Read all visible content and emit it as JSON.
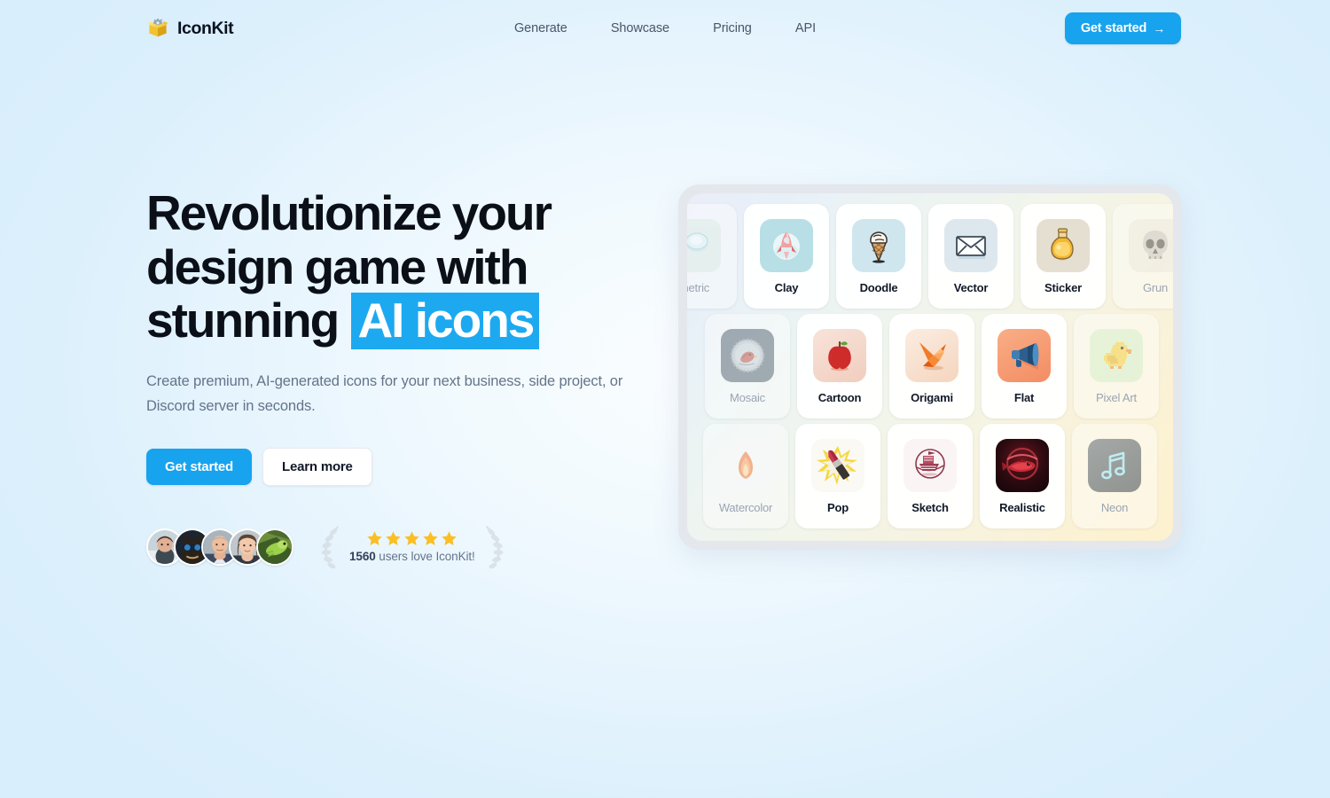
{
  "brand": {
    "name": "IconKit",
    "logo_icon": "gear-in-box-icon"
  },
  "nav": {
    "items": [
      {
        "label": "Generate"
      },
      {
        "label": "Showcase"
      },
      {
        "label": "Pricing"
      },
      {
        "label": "API"
      }
    ],
    "cta": {
      "label": "Get started",
      "arrow": "→"
    }
  },
  "hero": {
    "headline_plain": "Revolutionize your design game with stunning ",
    "headline_highlight": "AI icons",
    "subhead": "Create premium, AI-generated icons for your next business, side project, or Discord server in seconds.",
    "primary_cta": "Get started",
    "secondary_cta": "Learn more"
  },
  "social_proof": {
    "user_count": "1560",
    "rating_suffix": " users love IconKit!",
    "stars": 5,
    "avatars": [
      {
        "name": "avatar-1"
      },
      {
        "name": "avatar-2"
      },
      {
        "name": "avatar-3"
      },
      {
        "name": "avatar-4"
      },
      {
        "name": "avatar-5"
      }
    ]
  },
  "showcase": {
    "rows": [
      [
        {
          "label": "metric",
          "icon": "magnifier-icon",
          "dim": true
        },
        {
          "label": "Clay",
          "icon": "rocket-icon",
          "dim": false
        },
        {
          "label": "Doodle",
          "icon": "ice-cream-icon",
          "dim": false
        },
        {
          "label": "Vector",
          "icon": "envelope-icon",
          "dim": false
        },
        {
          "label": "Sticker",
          "icon": "juice-bottle-icon",
          "dim": false
        },
        {
          "label": "Grun",
          "icon": "skull-icon",
          "dim": true
        }
      ],
      [
        {
          "label": "Mosaic",
          "icon": "mosaic-bird-icon",
          "dim": true
        },
        {
          "label": "Cartoon",
          "icon": "apple-icon",
          "dim": false
        },
        {
          "label": "Origami",
          "icon": "paper-crane-icon",
          "dim": false
        },
        {
          "label": "Flat",
          "icon": "megaphone-icon",
          "dim": false
        },
        {
          "label": "Pixel Art",
          "icon": "duck-icon",
          "dim": true
        }
      ],
      [
        {
          "label": "Watercolor",
          "icon": "flame-icon",
          "dim": true
        },
        {
          "label": "Pop",
          "icon": "lipstick-icon",
          "dim": false
        },
        {
          "label": "Sketch",
          "icon": "boat-icon",
          "dim": false
        },
        {
          "label": "Realistic",
          "icon": "fish-icon",
          "dim": false
        },
        {
          "label": "Neon",
          "icon": "music-note-icon",
          "dim": true
        }
      ]
    ]
  },
  "colors": {
    "accent": "#17A3EE",
    "highlight": "#1DA9F0",
    "star": "#FBBF24",
    "background_edge": "#DCF0FC",
    "background_center": "#FAFDFF"
  }
}
